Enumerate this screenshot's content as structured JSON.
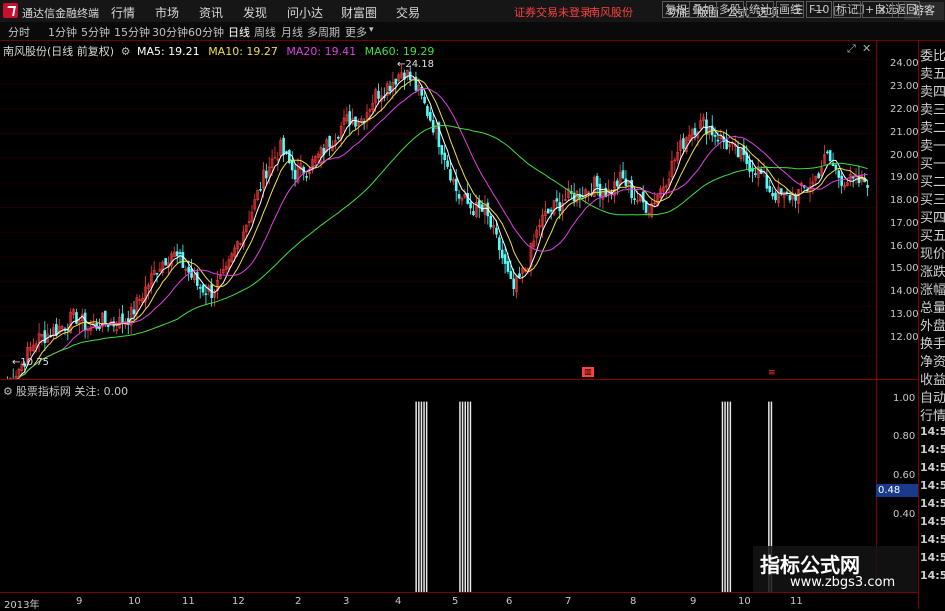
{
  "topbar": {
    "app_name": "通达信金融终端",
    "menu": [
      "行情",
      "市场",
      "资讯",
      "发现",
      "问小达",
      "财富圈",
      "交易"
    ],
    "warning": "证券交易未登录",
    "stock": "南风股份",
    "right_items": [
      "功能",
      "版面",
      "公式",
      "选项"
    ],
    "guest": "游客"
  },
  "toolbar": {
    "periods": [
      "分时",
      "1分钟",
      "5分钟",
      "15分钟",
      "30分钟",
      "60分钟",
      "日线",
      "周线",
      "月线",
      "多周期",
      "更多"
    ],
    "active_period": "日线",
    "right_buttons": [
      "复权",
      "叠加",
      "多股",
      "统计",
      "画线",
      "F10",
      "标记",
      "+自选",
      "返回"
    ]
  },
  "main": {
    "title": "南风股份(日线 前复权)",
    "ma": [
      {
        "label": "MA5: 19.21",
        "color": "#ffffff"
      },
      {
        "label": "MA10: 19.27",
        "color": "#f0e040"
      },
      {
        "label": "MA20: 19.41",
        "color": "#e040e0"
      },
      {
        "label": "MA60: 19.29",
        "color": "#40e040"
      }
    ],
    "high_label": "24.18",
    "low_label": "10.75",
    "price_ticks": [
      "24.00",
      "23.00",
      "22.00",
      "21.00",
      "20.00",
      "19.00",
      "18.00",
      "17.00",
      "16.00",
      "15.00",
      "14.00",
      "13.00",
      "12.00"
    ]
  },
  "sidebar": {
    "items": [
      "委比",
      "卖五",
      "卖四",
      "卖三",
      "卖二",
      "卖一",
      "买一",
      "买二",
      "买三",
      "买四",
      "买五",
      "现价",
      "涨跌",
      "涨幅",
      "总量",
      "外盘",
      "换手",
      "净资",
      "收益",
      "自动",
      "行情",
      "14:50",
      "14:50",
      "14:50",
      "14:50",
      "14:50",
      "14:50",
      "14:50",
      "14:50",
      "14:50"
    ]
  },
  "sub": {
    "title": "股票指标网 关注: 0.00",
    "ticks": [
      "1.00",
      "0.80",
      "0.60",
      "0.40"
    ],
    "current": "0.48"
  },
  "time_axis": [
    "2013年",
    "9",
    "10",
    "11",
    "12",
    "2",
    "3",
    "4",
    "5",
    "6",
    "7",
    "8",
    "9",
    "10",
    "11"
  ],
  "watermark": {
    "line1": "指标公式网",
    "line2": "www.zbgs3.com"
  },
  "chart_data": {
    "type": "candlestick",
    "title": "南风股份(日线 前复权)",
    "ylim": [
      11.3,
      24.5
    ],
    "high": 24.18,
    "low": 10.75,
    "ma_latest": {
      "MA5": 19.21,
      "MA10": 19.27,
      "MA20": 19.41,
      "MA60": 19.29
    },
    "close_path": [
      10.9,
      11.6,
      12.6,
      12.9,
      13.2,
      13.6,
      13.1,
      13.4,
      13.3,
      13.6,
      14.6,
      15.6,
      16.2,
      15.6,
      14.8,
      14.6,
      15.3,
      16.8,
      18.0,
      19.6,
      20.4,
      19.4,
      19.6,
      20.2,
      21.0,
      21.6,
      21.6,
      22.6,
      23.0,
      23.6,
      22.8,
      21.6,
      20.2,
      18.5,
      18.0,
      17.8,
      16.4,
      14.6,
      15.6,
      17.4,
      18.0,
      18.4,
      18.6,
      18.9,
      18.6,
      19.2,
      18.4,
      18.0,
      18.9,
      20.1,
      21.2,
      21.4,
      20.9,
      20.4,
      19.9,
      19.5,
      18.6,
      18.4,
      18.6,
      19.0,
      20.1,
      19.2,
      19.0,
      19.1
    ],
    "signal_bars": [
      {
        "x_frac": 0.4748,
        "height": 1.0
      },
      {
        "x_frac": 0.4778,
        "height": 1.0
      },
      {
        "x_frac": 0.4808,
        "height": 1.0
      },
      {
        "x_frac": 0.4838,
        "height": 1.0
      },
      {
        "x_frac": 0.4868,
        "height": 1.0
      },
      {
        "x_frac": 0.5248,
        "height": 1.0
      },
      {
        "x_frac": 0.5278,
        "height": 1.0
      },
      {
        "x_frac": 0.5308,
        "height": 1.0
      },
      {
        "x_frac": 0.5338,
        "height": 1.0
      },
      {
        "x_frac": 0.5368,
        "height": 1.0
      },
      {
        "x_frac": 0.8248,
        "height": 1.0
      },
      {
        "x_frac": 0.8278,
        "height": 1.0
      },
      {
        "x_frac": 0.8308,
        "height": 1.0
      },
      {
        "x_frac": 0.8338,
        "height": 1.0
      },
      {
        "x_frac": 0.8778,
        "height": 1.0
      },
      {
        "x_frac": 0.8808,
        "height": 1.0
      }
    ],
    "sub_ylim": [
      0.3,
      1.05
    ]
  }
}
